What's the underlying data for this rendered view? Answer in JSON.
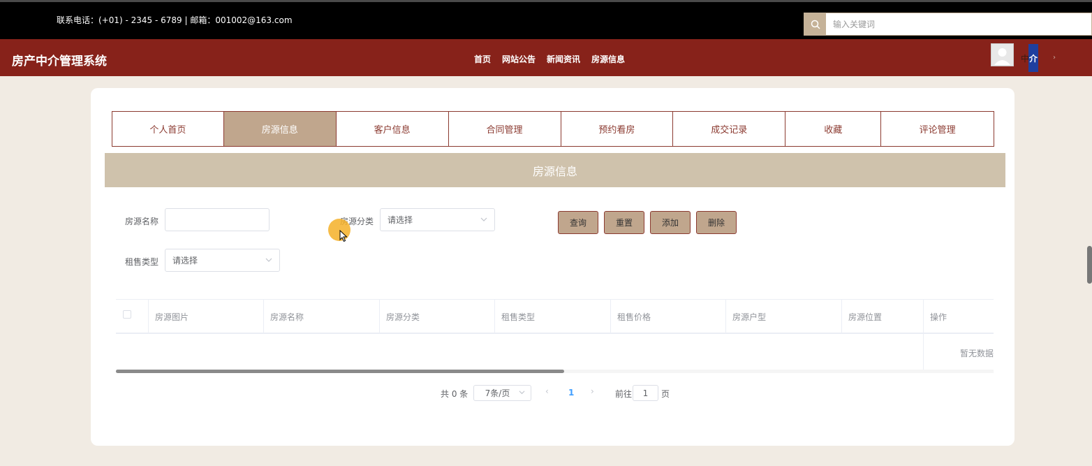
{
  "topbar": {
    "contact": "联系电话：(+01) - 2345 - 6789 | 邮箱：001002@163.com",
    "search_placeholder": "输入关键词"
  },
  "header": {
    "brand": "房产中介管理系统",
    "nav": [
      "首页",
      "网站公告",
      "新闻资讯",
      "房源信息"
    ],
    "user_name": "中",
    "user_badge": "介",
    "user_arrow": "›"
  },
  "tabs": [
    {
      "label": "个人首页",
      "active": false
    },
    {
      "label": "房源信息",
      "active": true
    },
    {
      "label": "客户信息",
      "active": false
    },
    {
      "label": "合同管理",
      "active": false
    },
    {
      "label": "预约看房",
      "active": false
    },
    {
      "label": "成交记录",
      "active": false
    },
    {
      "label": "收藏",
      "active": false
    },
    {
      "label": "评论管理",
      "active": false
    }
  ],
  "section_title": "房源信息",
  "filters": {
    "name_label": "房源名称",
    "name_value": "",
    "category_label": "房源分类",
    "category_placeholder": "请选择",
    "type_label": "租售类型",
    "type_placeholder": "请选择"
  },
  "buttons": {
    "query": "查询",
    "reset": "重置",
    "add": "添加",
    "delete": "删除"
  },
  "table": {
    "columns": [
      "房源图片",
      "房源名称",
      "房源分类",
      "租售类型",
      "租售价格",
      "房源户型",
      "房源位置",
      "操作"
    ],
    "empty_text": "暂无数据"
  },
  "pagination": {
    "total": "共 0 条",
    "page_size": "7条/页",
    "prev": "‹",
    "current_page": "1",
    "next": "›",
    "goto_label": "前往",
    "goto_value": "1",
    "page_suffix": "页"
  },
  "colors": {
    "nav_red": "#87221a",
    "accent_tan": "#c0a68d",
    "section_tan": "#cfc2ac"
  }
}
